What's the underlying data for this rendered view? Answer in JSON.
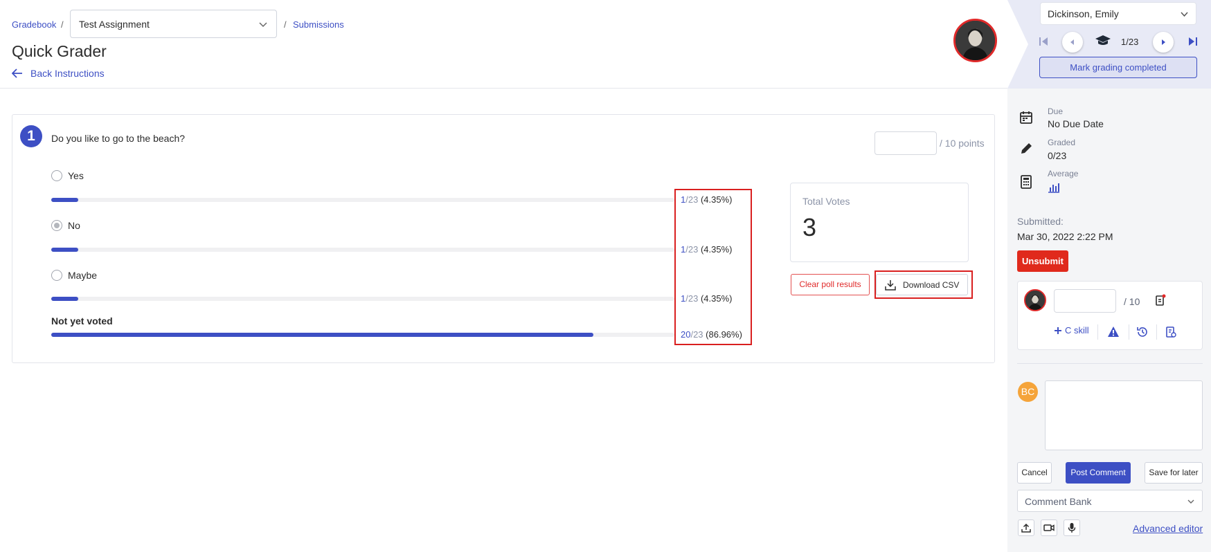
{
  "breadcrumb": {
    "gradebook": "Gradebook",
    "sep1": "/",
    "assignment": "Test Assignment",
    "sep2": "/",
    "submissions": "Submissions"
  },
  "header": {
    "title": "Quick Grader",
    "back_label": "Back Instructions"
  },
  "student_nav": {
    "student": "Dickinson, Emily",
    "position": "1/23",
    "mark_completed": "Mark grading completed"
  },
  "question": {
    "number": "1",
    "text": "Do you like to go to the beach?",
    "points_suffix": "/ 10 points",
    "options": [
      {
        "label": "Yes",
        "selected": false,
        "count": "1",
        "total": "/23",
        "percent": "(4.35%)",
        "fraction": 0.0435
      },
      {
        "label": "No",
        "selected": true,
        "count": "1",
        "total": "/23",
        "percent": "(4.35%)",
        "fraction": 0.0435
      },
      {
        "label": "Maybe",
        "selected": false,
        "count": "1",
        "total": "/23",
        "percent": "(4.35%)",
        "fraction": 0.0435
      }
    ],
    "not_voted": {
      "label": "Not yet voted",
      "count": "20",
      "total": "/23",
      "percent": "(86.96%)",
      "fraction": 0.8696
    }
  },
  "votes": {
    "label": "Total Votes",
    "value": "3"
  },
  "poll_actions": {
    "clear": "Clear poll results",
    "download": "Download CSV"
  },
  "side": {
    "due_label": "Due",
    "due_value": "No Due Date",
    "graded_label": "Graded",
    "graded_value": "0/23",
    "average_label": "Average",
    "submitted_label": "Submitted:",
    "submitted_value": "Mar 30, 2022 2:22 PM",
    "unsubmit": "Unsubmit",
    "grade_of": "/ 10",
    "skill": "C skill"
  },
  "comment": {
    "initials": "BC",
    "cancel": "Cancel",
    "post": "Post Comment",
    "save_later": "Save for later",
    "bank": "Comment Bank",
    "advanced": "Advanced editor"
  },
  "colors": {
    "accent": "#3d4fc4",
    "danger": "#e02a1c",
    "highlight": "#d91f1f"
  }
}
